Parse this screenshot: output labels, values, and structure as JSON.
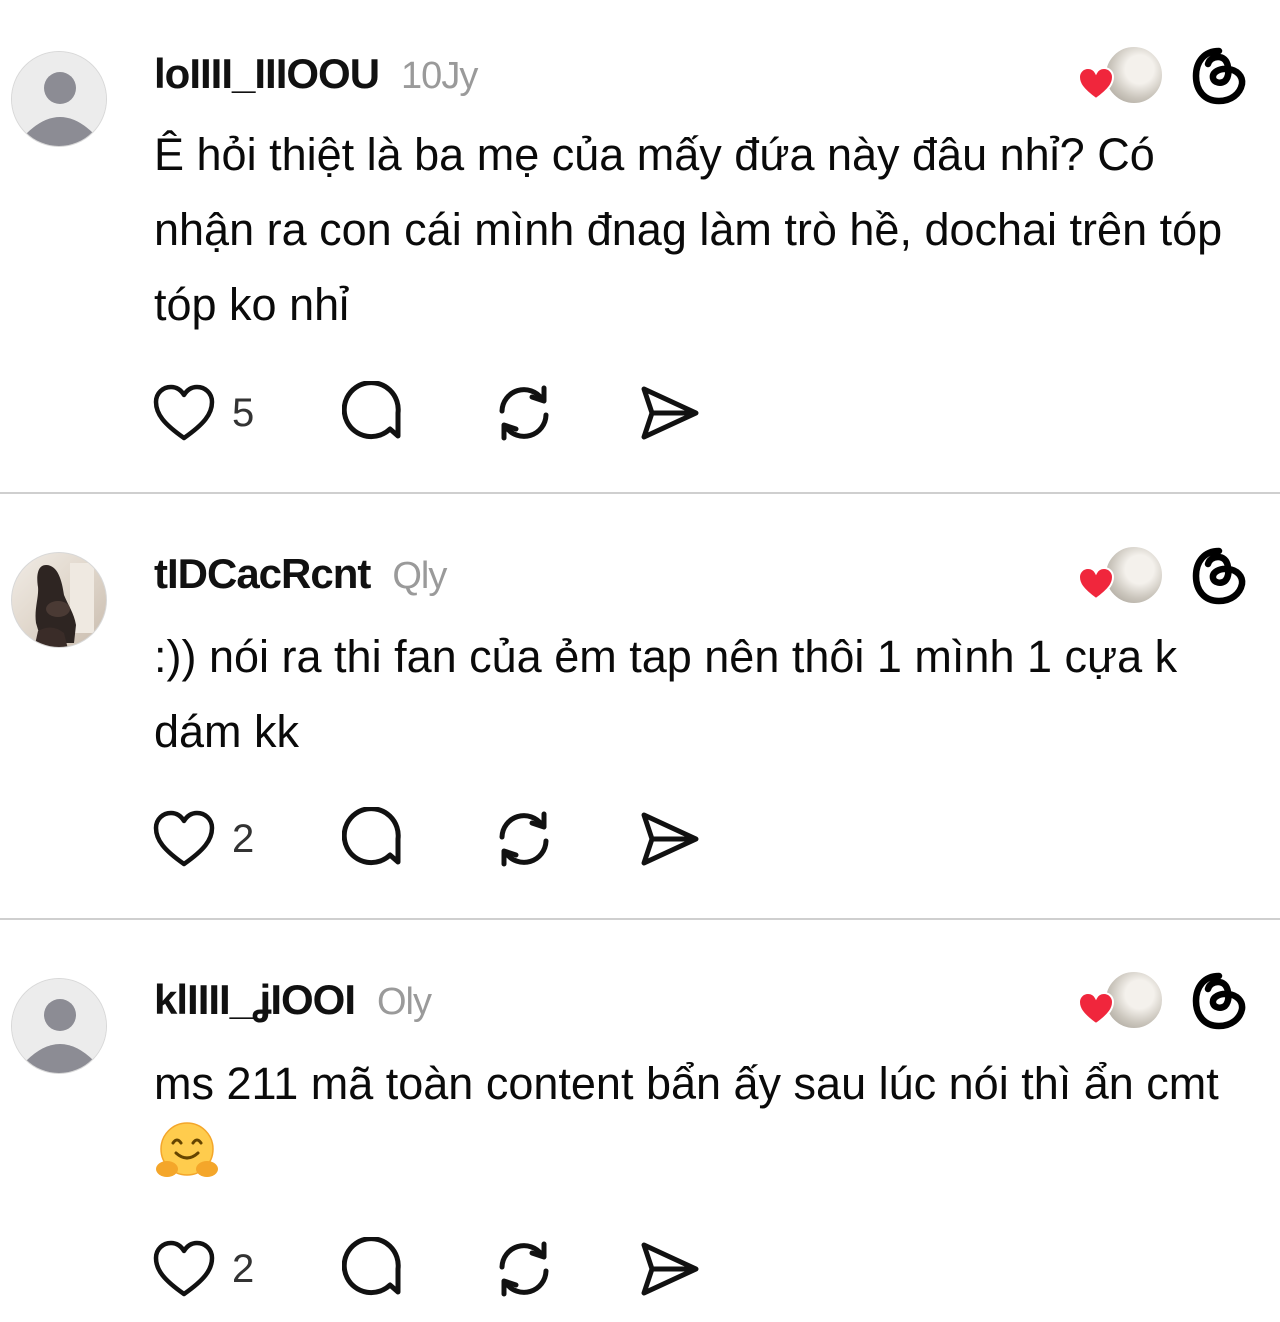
{
  "colors": {
    "heart_red": "#f0263c",
    "divider": "#cfcfcf",
    "time_gray": "#9a9a9a"
  },
  "posts": [
    {
      "username": "loIIII_IIIOOU",
      "time": "10Jy",
      "text": "Ê hỏi thiệt là ba mẹ của mấy đứa này đâu nhỉ? Có nhận ra con cái mình đnag làm trò hề, dochai trên tóp tóp ko nhỉ",
      "likes": "5",
      "avatar": "default-avatar-icon"
    },
    {
      "username": "tIDCacRcnt",
      "time": "Qly",
      "text": ":)) nói ra thi fan của ẻm tap nên thôi 1 mình 1 cựa k dám kk",
      "likes": "2",
      "avatar": "user-photo-avatar"
    },
    {
      "username": "klIIII_ʝIOOI",
      "time": "Oly",
      "text": "ms 211 mã toàn content bẩn ấy sau lúc nói thì ẩn cmt",
      "emoji": "🤗",
      "likes": "2",
      "avatar": "default-avatar-icon"
    }
  ]
}
